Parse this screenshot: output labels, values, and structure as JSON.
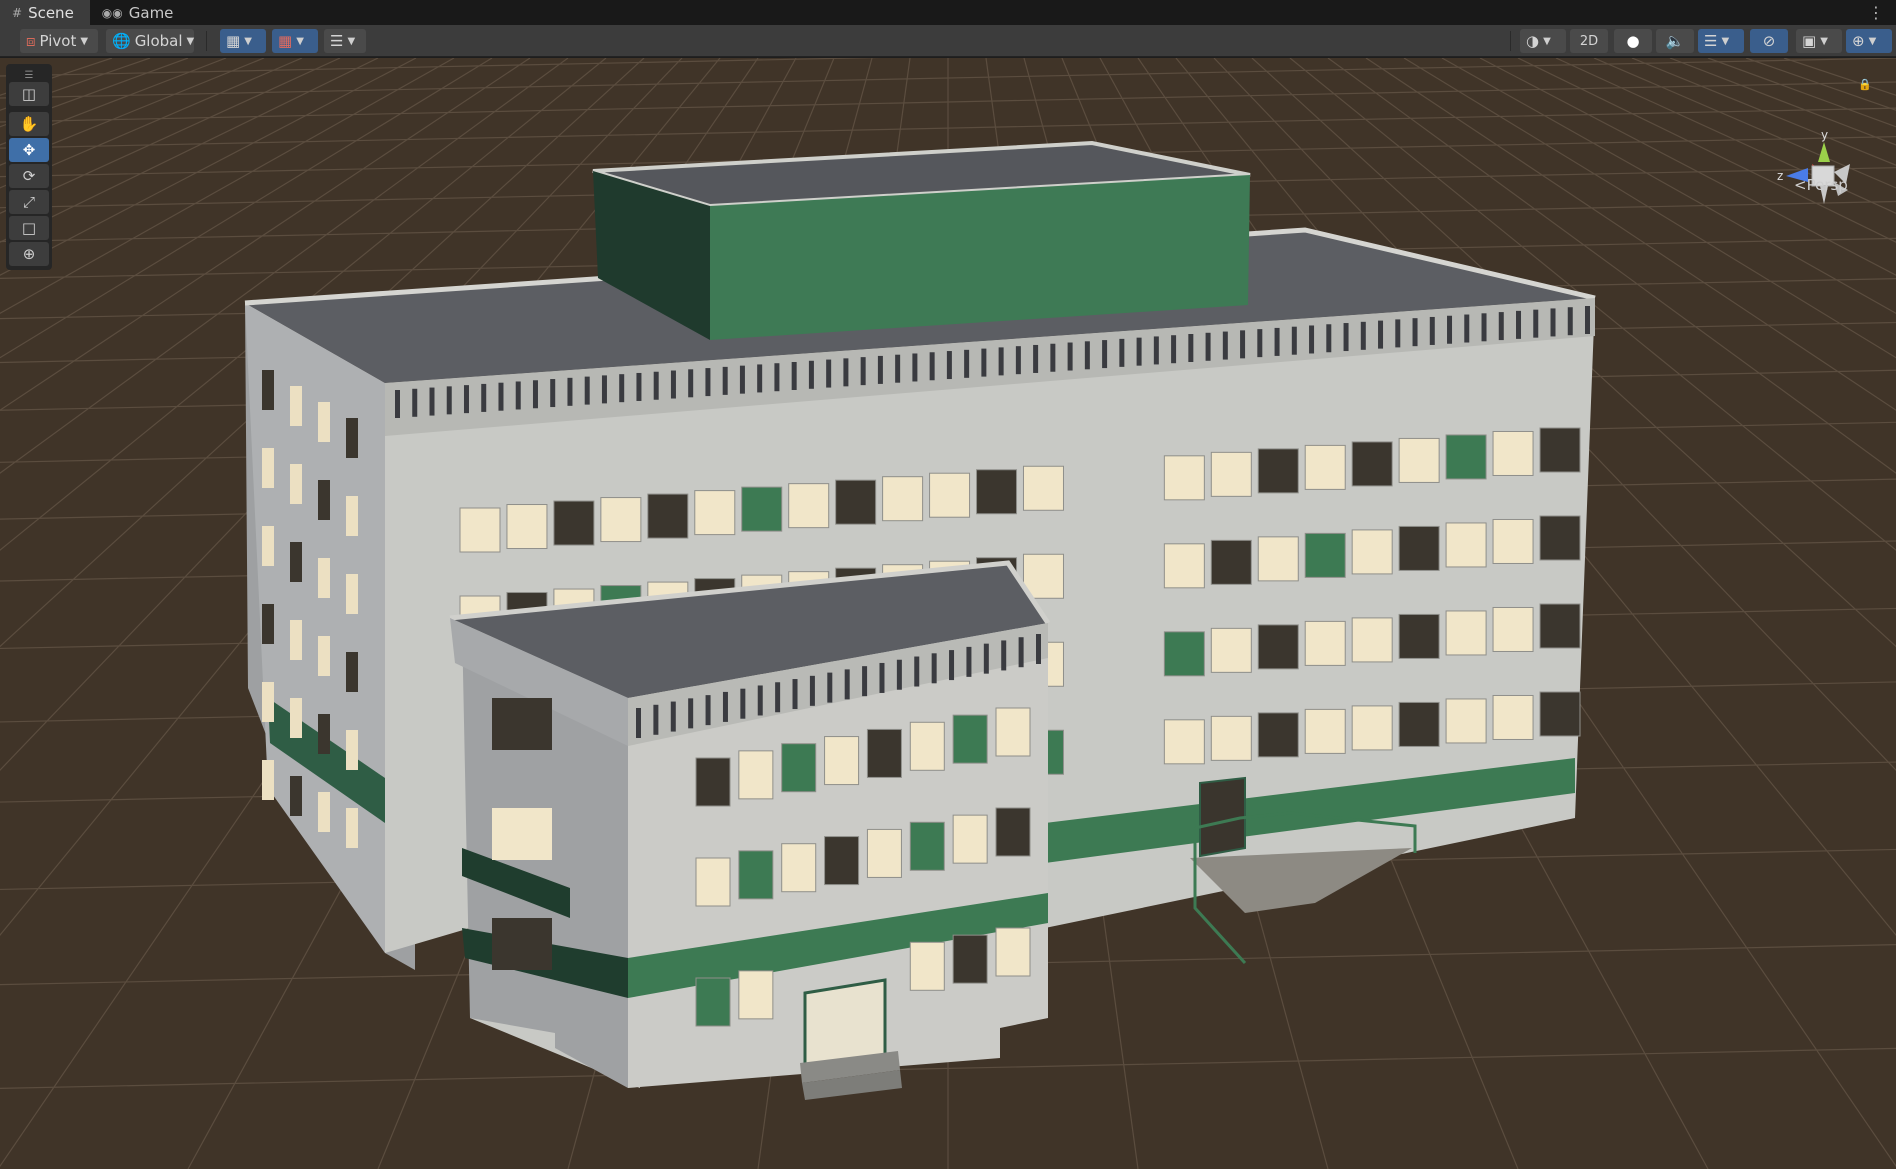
{
  "tabs": [
    {
      "label": "Scene",
      "icon": "grid-icon",
      "active": true
    },
    {
      "label": "Game",
      "icon": "gamepad-icon",
      "active": false
    }
  ],
  "toolbar": {
    "pivot_label": "Pivot",
    "global_label": "Global",
    "mode_2d_label": "2D"
  },
  "tools": [
    {
      "name": "view-tool",
      "active": false
    },
    {
      "name": "move-tool",
      "active": true
    },
    {
      "name": "rotate-tool",
      "active": false
    },
    {
      "name": "scale-tool",
      "active": false
    },
    {
      "name": "rect-tool",
      "active": false
    },
    {
      "name": "transform-tool",
      "active": false
    }
  ],
  "gizmo": {
    "y_label": "y",
    "z_label": "z",
    "projection_label": "Persp"
  },
  "colors": {
    "ground": "#403428",
    "grid_line": "#5b4d3f",
    "wall": "#c6c7c3",
    "accent_green": "#3f7a55",
    "roof": "#5b5d62",
    "window_lit": "#f1e6c9",
    "window_dark": "#3b362e",
    "active_blue": "#3f6fa8"
  }
}
